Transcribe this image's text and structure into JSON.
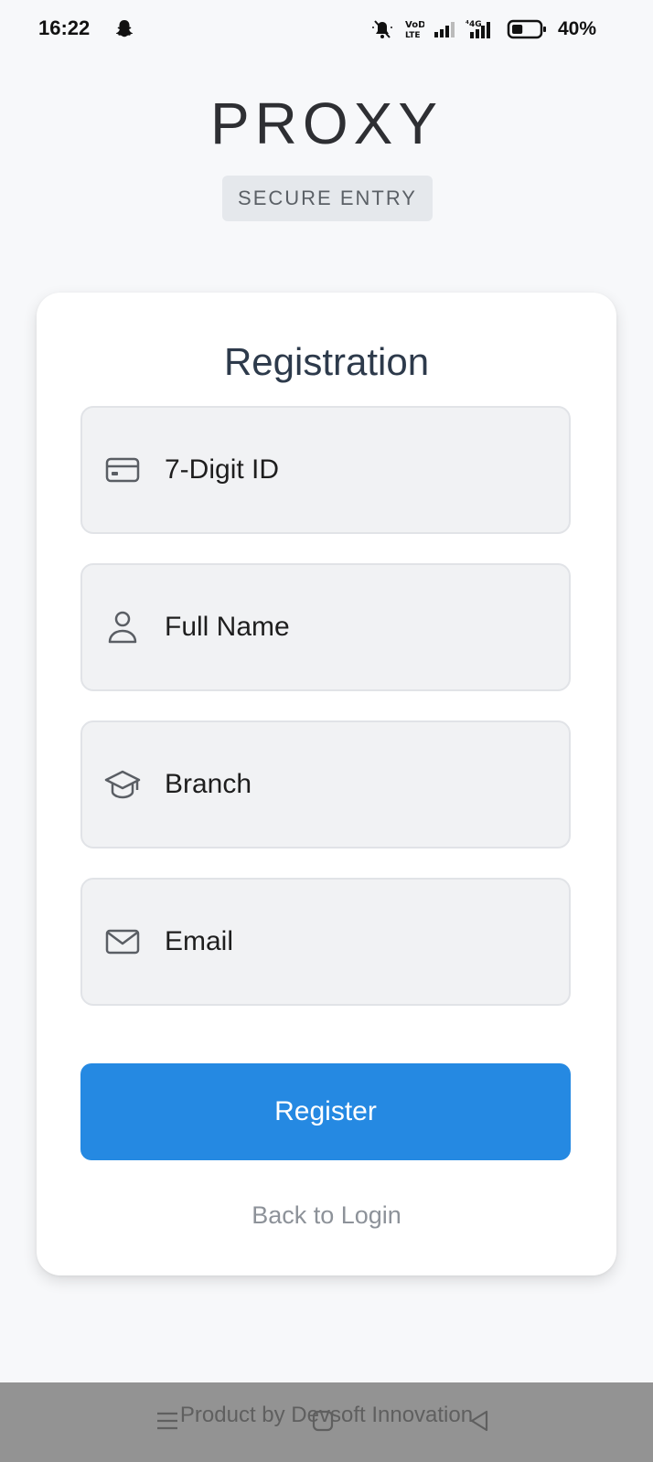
{
  "status_bar": {
    "time": "16:22",
    "battery_percent": "40%",
    "battery_level": 0.4,
    "icons": [
      "snapchat-icon",
      "mute-icon",
      "volte-icon",
      "signal-icon",
      "4g-signal-icon",
      "battery-icon"
    ]
  },
  "header": {
    "brand": "PROXY",
    "badge": "SECURE ENTRY"
  },
  "form": {
    "title": "Registration",
    "fields": [
      {
        "icon": "id-card-icon",
        "label": "7-Digit ID"
      },
      {
        "icon": "user-icon",
        "label": "Full Name"
      },
      {
        "icon": "graduation-cap-icon",
        "label": "Branch"
      },
      {
        "icon": "mail-icon",
        "label": "Email"
      }
    ],
    "submit_label": "Register",
    "back_link": "Back to Login"
  },
  "footer": {
    "text": "Product by Devsoft Innovation"
  },
  "nav_bar": {
    "icons": [
      "menu-icon",
      "home-icon",
      "back-icon"
    ]
  },
  "colors": {
    "accent": "#2589e2",
    "background": "#f7f8fa",
    "card": "#ffffff",
    "field": "#f1f2f4"
  }
}
